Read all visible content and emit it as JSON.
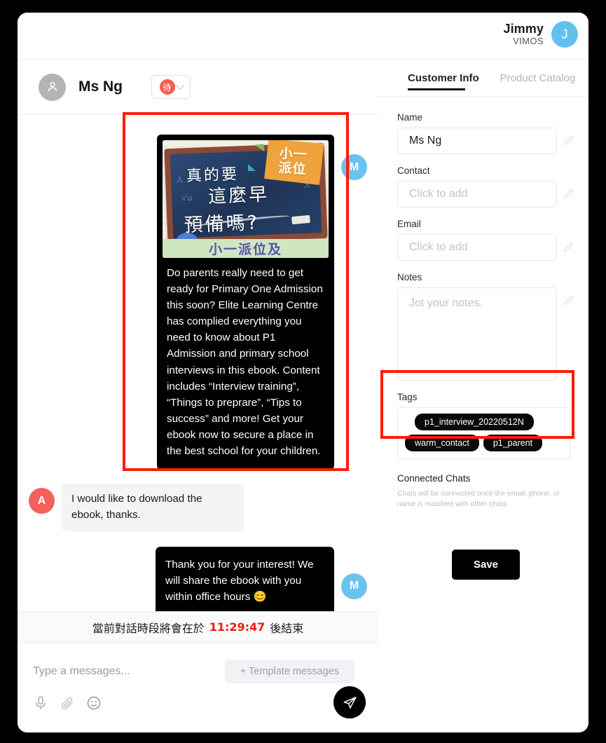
{
  "account": {
    "name": "Jimmy",
    "org": "VIMOS",
    "avatar_initial": "J",
    "avatar_color": "#63c0ee"
  },
  "chat_header": {
    "contact_name": "Ms Ng",
    "status_badge": "待",
    "status_badge_color": "#f65d52"
  },
  "messages": [
    {
      "direction": "out",
      "avatar_initial": "M",
      "avatar_color": "#6cc2ef",
      "has_image": true,
      "image": {
        "line1": "真的要",
        "line2": "這麼早",
        "line3": "預備嗎?",
        "tag_line1": "小一",
        "tag_line2": "派位",
        "caption": "小一派位及"
      },
      "text": "Do parents really need to get ready for Primary One Admission this soon? Elite Learning Centre has complied everything you need to know about P1 Admission and primary school interviews in this ebook. Content includes “Interview training”, “Things to preprare”, “Tips to success” and more! Get your ebook now to secure a place in the best school for your children."
    },
    {
      "direction": "in",
      "avatar_initial": "A",
      "avatar_color": "#f4615b",
      "has_image": false,
      "text": "I would like to download the ebook, thanks."
    },
    {
      "direction": "out",
      "avatar_initial": "M",
      "avatar_color": "#6cc2ef",
      "has_image": false,
      "text": "Thank you for your interest! We will share the ebook with you within office hours 😊"
    }
  ],
  "session_timer": {
    "prefix": "當前對話時段將會在於",
    "time": "11:29:47",
    "suffix": "後結束",
    "time_color": "#f31b0c"
  },
  "composer": {
    "placeholder": "Type a messages...",
    "template_button": "+ Template messages"
  },
  "panel": {
    "tabs": [
      {
        "label": "Customer Info",
        "active": true
      },
      {
        "label": "Product Catalog",
        "active": false
      }
    ],
    "fields": {
      "name_label": "Name",
      "name_value": "Ms Ng",
      "contact_label": "Contact",
      "contact_placeholder": "Click to add",
      "email_label": "Email",
      "email_placeholder": "Click to add",
      "notes_label": "Notes",
      "notes_placeholder": "Jot your notes."
    },
    "tags": {
      "label": "Tags",
      "items": [
        "p1_interview_20220512N",
        "warm_contact",
        "p1_parent"
      ]
    },
    "connected_chats": {
      "title": "Connected Chats",
      "description": "Chats will be connected once the email, phone, or name is matched with other chats"
    },
    "save_label": "Save"
  },
  "annotations": {
    "highlight_color": "#fd1c06",
    "boxes": [
      "message-bubble-highlight",
      "tags-highlight"
    ]
  }
}
